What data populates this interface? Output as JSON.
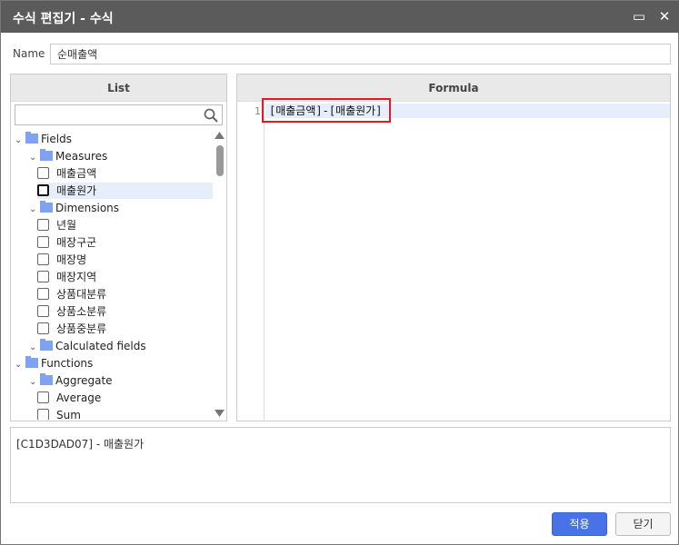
{
  "window": {
    "title": "수식 편집기 - 수식",
    "maximize_icon": "▭",
    "close_icon": "✕"
  },
  "name": {
    "label": "Name",
    "value": "순매출액"
  },
  "list": {
    "header": "List",
    "search_placeholder": "",
    "tree": [
      {
        "type": "folder",
        "label": "Fields",
        "level": 0
      },
      {
        "type": "folder",
        "label": "Measures",
        "level": 1
      },
      {
        "type": "item",
        "label": "매출금액",
        "level": 2
      },
      {
        "type": "item",
        "label": "매출원가",
        "level": 2,
        "selected": true
      },
      {
        "type": "folder",
        "label": "Dimensions",
        "level": 1
      },
      {
        "type": "item",
        "label": "년월",
        "level": 2
      },
      {
        "type": "item",
        "label": "매장구군",
        "level": 2
      },
      {
        "type": "item",
        "label": "매장명",
        "level": 2
      },
      {
        "type": "item",
        "label": "매장지역",
        "level": 2
      },
      {
        "type": "item",
        "label": "상품대분류",
        "level": 2
      },
      {
        "type": "item",
        "label": "상품소분류",
        "level": 2
      },
      {
        "type": "item",
        "label": "상품중분류",
        "level": 2
      },
      {
        "type": "folder",
        "label": "Calculated fields",
        "level": 1
      },
      {
        "type": "folder",
        "label": "Functions",
        "level": 0
      },
      {
        "type": "folder",
        "label": "Aggregate",
        "level": 1
      },
      {
        "type": "item",
        "label": "Average",
        "level": 2
      },
      {
        "type": "item",
        "label": "Sum",
        "level": 2
      }
    ]
  },
  "formula": {
    "header": "Formula",
    "line_number": "1",
    "code": "[매출금액]-[매출원가]"
  },
  "description": "[C1D3DAD07] - 매출원가",
  "buttons": {
    "apply": "적용",
    "close": "닫기"
  }
}
